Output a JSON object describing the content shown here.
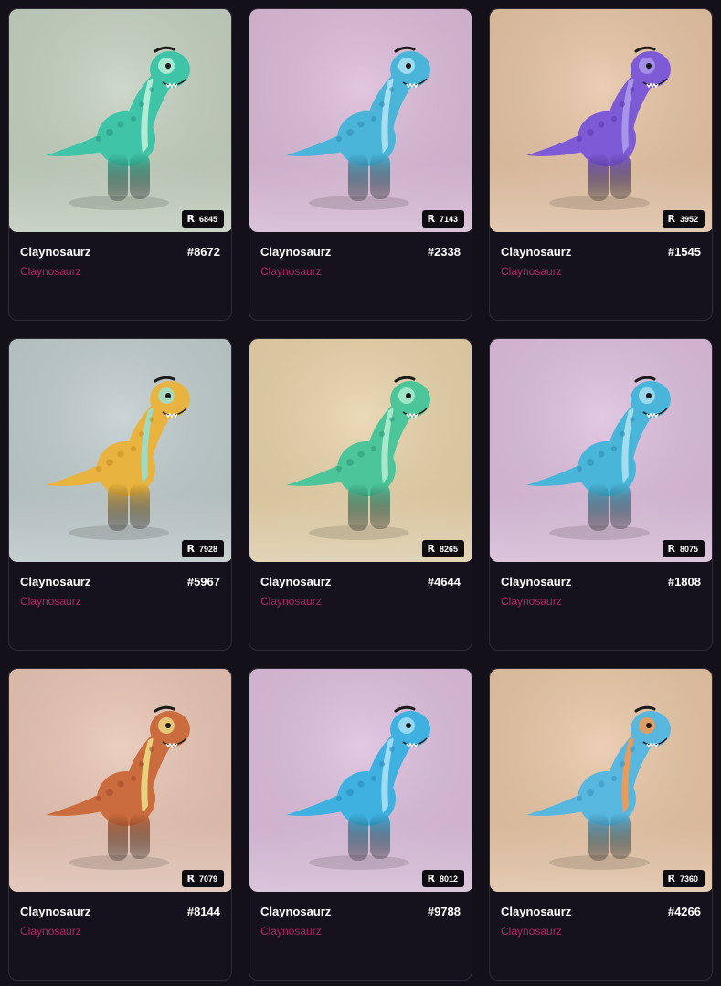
{
  "rank_icon": "R",
  "cards": [
    {
      "title": "Claynosaurz",
      "number": "#8672",
      "collection": "Claynosaurz",
      "rank": "6845",
      "bg": "#c3d0bf",
      "body": "#3fc4a7",
      "belly": "#b3ecd5",
      "spots": "#2a9a85"
    },
    {
      "title": "Claynosaurz",
      "number": "#2338",
      "collection": "Claynosaurz",
      "rank": "7143",
      "bg": "#dbbad8",
      "body": "#4bb5d9",
      "belly": "#a7dff0",
      "spots": "#2f8fb8"
    },
    {
      "title": "Claynosaurz",
      "number": "#1545",
      "collection": "Claynosaurz",
      "rank": "3952",
      "bg": "#e6c3a3",
      "body": "#7d5ad6",
      "belly": "#a795e8",
      "spots": "#5e3ab3"
    },
    {
      "title": "Claynosaurz",
      "number": "#5967",
      "collection": "Claynosaurz",
      "rank": "7928",
      "bg": "#bfcbcb",
      "body": "#e8b33e",
      "belly": "#9edbc6",
      "spots": "#c98d26"
    },
    {
      "title": "Claynosaurz",
      "number": "#4644",
      "collection": "Claynosaurz",
      "rank": "8265",
      "bg": "#e7d2a8",
      "body": "#4cc59a",
      "belly": "#a9e8cc",
      "spots": "#2e9a77"
    },
    {
      "title": "Claynosaurz",
      "number": "#1808",
      "collection": "Claynosaurz",
      "rank": "8075",
      "bg": "#dcbddc",
      "body": "#49b5d8",
      "belly": "#a5dcee",
      "spots": "#2b8db5"
    },
    {
      "title": "Claynosaurz",
      "number": "#8144",
      "collection": "Claynosaurz",
      "rank": "7079",
      "bg": "#e8c4b3",
      "body": "#cb6c3e",
      "belly": "#e9d27e",
      "spots": "#a44a2e"
    },
    {
      "title": "Claynosaurz",
      "number": "#9788",
      "collection": "Claynosaurz",
      "rank": "8012",
      "bg": "#dcbddc",
      "body": "#3fb1e0",
      "belly": "#a0dcf3",
      "spots": "#2a89bd"
    },
    {
      "title": "Claynosaurz",
      "number": "#4266",
      "collection": "Claynosaurz",
      "rank": "7360",
      "bg": "#e8c5a4",
      "body": "#58b7df",
      "belly": "#ec9a57",
      "spots": "#3b93c0"
    }
  ]
}
